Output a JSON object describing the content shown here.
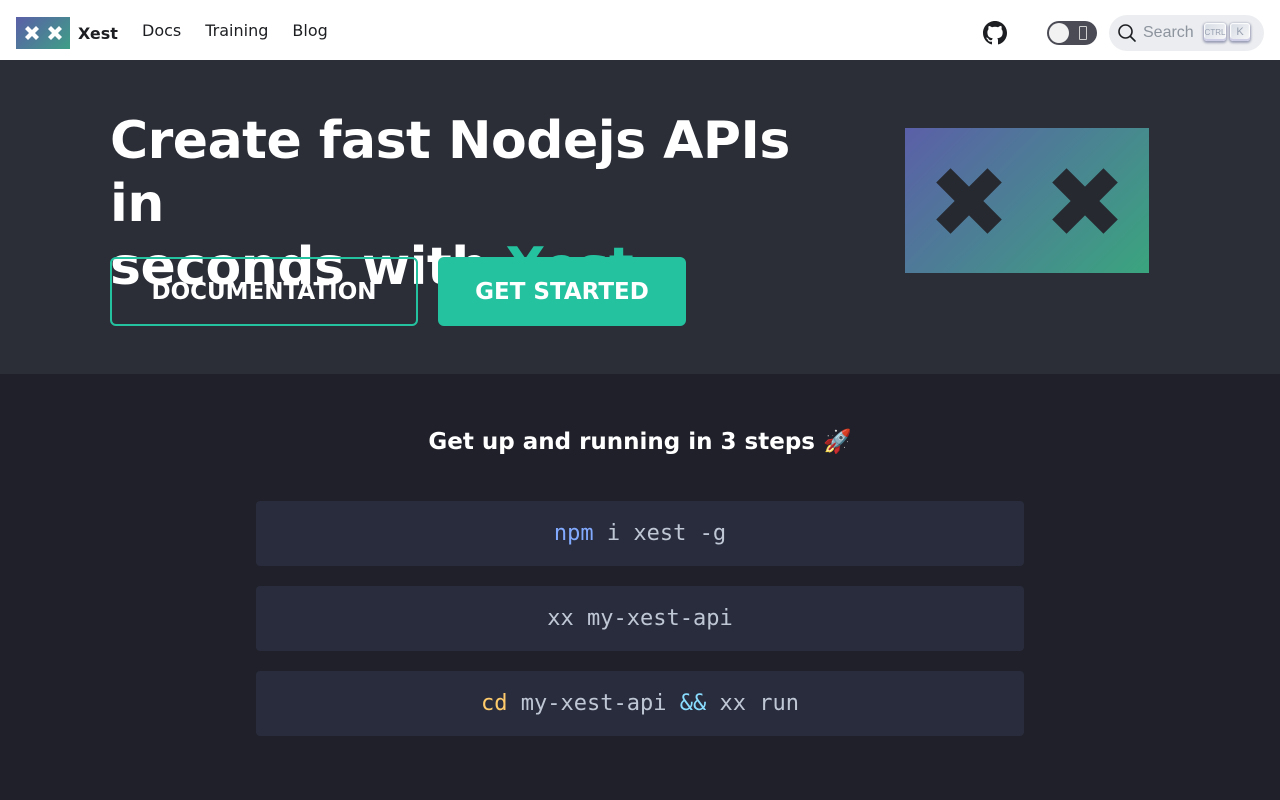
{
  "navbar": {
    "brand": "Xest",
    "links": [
      "Docs",
      "Training",
      "Blog"
    ],
    "search_placeholder": "Search",
    "kbd_ctrl": "CTRL",
    "kbd_k": "K"
  },
  "hero": {
    "title_line1": "Create fast Nodejs APIs in",
    "title_line2_prefix": "seconds with ",
    "title_accent": "Xest",
    "btn_documentation": "DOCUMENTATION",
    "btn_get_started": "GET STARTED"
  },
  "steps": {
    "title": "Get up and running in 3 steps 🚀",
    "step1": {
      "cmd": "npm",
      "rest": " i xest -g"
    },
    "step2": {
      "text": "xx my-xest-api"
    },
    "step3": {
      "cmd": "cd",
      "mid": " my-xest-api ",
      "op": "&&",
      "rest": " xx run"
    }
  },
  "colors": {
    "accent": "#25c2a0",
    "hero_bg": "#2b2e37",
    "page_bg": "#1f2029",
    "code_bg": "#292c3d"
  },
  "icons": [
    "xest-logo-icon",
    "github-icon",
    "theme-toggle-icon",
    "search-icon"
  ]
}
